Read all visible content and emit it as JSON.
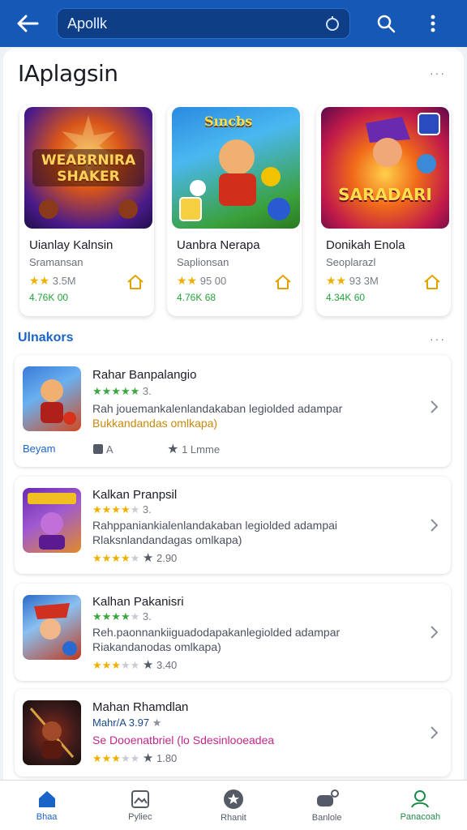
{
  "topbar": {
    "search_value": "Apollk",
    "icons": {
      "back": "arrow-left-icon",
      "mic": "mic-icon",
      "search": "search-icon",
      "more": "more-vert-icon"
    },
    "accent": "#1558b5"
  },
  "page": {
    "title": "IAplagsin",
    "more_label": "···"
  },
  "featured": [
    {
      "art_title": "WEABRNIRA SHAKER",
      "name": "Uianlay Kalnsin",
      "sub": "Sramansan",
      "rating": "3.5M",
      "price": "4.76K 00",
      "art_colors": [
        "#3a1a8a",
        "#e0601a"
      ]
    },
    {
      "art_title": "Sıncbs",
      "name": "Uanbra Nerapa",
      "sub": "Saplionsan",
      "rating": "95 00",
      "price": "4.76K 68",
      "art_colors": [
        "#1a7ad0",
        "#3aa03a"
      ]
    },
    {
      "art_title": "SARADARI",
      "name": "Donikah Enola",
      "sub": "Seoplarazl",
      "rating": "93 3M",
      "price": "4.34K 60",
      "art_colors": [
        "#b01a4a",
        "#f08a1a"
      ]
    }
  ],
  "section": {
    "title": "Ulnakors",
    "more_label": "···"
  },
  "list": [
    {
      "title": "Rahar Banpalangio",
      "rating": "3.",
      "desc": "Rah jouemankalenlandakaban legiolded adampar",
      "desc2": "Bukkandandas omlkapa)",
      "desc2_color": "#c8890a",
      "badge": "Beyam",
      "meta1": "A",
      "meta2": "1 Lmme",
      "thumb_colors": [
        "#3a7ad8",
        "#d04a20"
      ]
    },
    {
      "title": "Kalkan Pranpsil",
      "rating": "3.",
      "desc": "Rahppaniankialenlandakaban legiolded adampai",
      "desc2": "Rlaksnlandandagas omlkapa)",
      "desc2_color": "#4b5060",
      "price": "2.90",
      "thumb_colors": [
        "#6a2ab0",
        "#e08a2a"
      ]
    },
    {
      "title": "Kalhan Pakanisri",
      "rating": "3.",
      "desc": "Reh.paonnankiiguadodapakanlegiolded adampar",
      "desc2": "Riakandanodas omlkapa)",
      "desc2_color": "#4b5060",
      "price": "3.40",
      "thumb_colors": [
        "#2a6ac8",
        "#c03a20"
      ]
    },
    {
      "title": "Mahan Rhamdlan",
      "rating": "Mahr/A 3.97",
      "desc": "Se Dooenatbriel (lo Sdesinlooeadea",
      "price": "1.80",
      "thumb_colors": [
        "#2a1a1a",
        "#8a2a1a"
      ]
    }
  ],
  "nav": [
    {
      "label": "Bhaa",
      "icon": "home-icon",
      "state": "active"
    },
    {
      "label": "Pyliec",
      "icon": "image-icon",
      "state": ""
    },
    {
      "label": "Rhanit",
      "icon": "star-circle-icon",
      "state": ""
    },
    {
      "label": "Banlole",
      "icon": "games-icon",
      "state": ""
    },
    {
      "label": "Panacoah",
      "icon": "person-icon",
      "state": "alt"
    }
  ]
}
